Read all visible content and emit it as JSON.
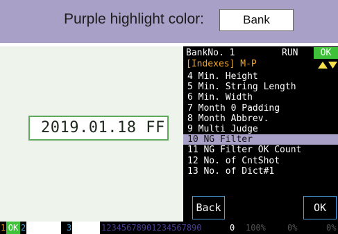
{
  "banner": {
    "label": "Purple highlight color:",
    "value": "Bank"
  },
  "preview": {
    "date_text": "2019.01.18 FF"
  },
  "screen": {
    "bank_no": "BankNo. 1",
    "run": "RUN",
    "ok": "OK",
    "indexes": "[Indexes] M-P",
    "menu": [
      "4 Min. Height",
      "5 Min. String Length",
      "6 Min. Width",
      "7 Month 0 Padding",
      "8 Month Abbrev.",
      "9 Multi Judge",
      "10 NG Filter",
      "11 NG Filter OK Count",
      "12 No. of CntShot",
      "13 No. of Dict#1"
    ],
    "selected_index": 6,
    "highlight_color": "#a9a0c8",
    "back_label": "Back",
    "ok_label": "OK"
  },
  "status": {
    "slot1": "1",
    "ok": "OK",
    "slot2": "2",
    "slot3": "3",
    "digits": "12345678901234567890",
    "zero": "0",
    "pct1": "100%",
    "pct2": "0%",
    "pct3": "0%"
  }
}
